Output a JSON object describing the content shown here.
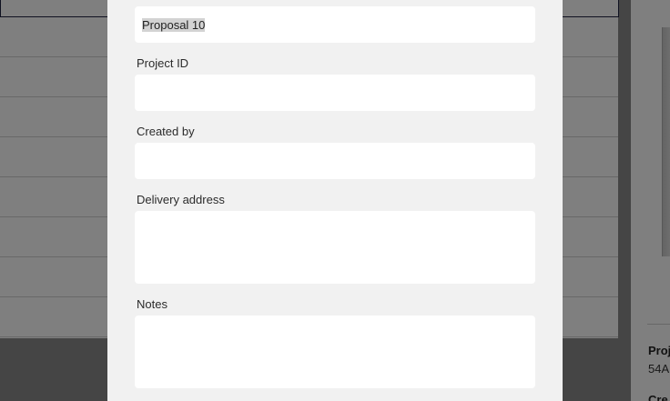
{
  "background": {
    "meta": {
      "project_label": "Proj",
      "project_value": "54A",
      "created_label": "Cre"
    }
  },
  "modal": {
    "fields": {
      "name": {
        "value": "Proposal 10"
      },
      "project_id": {
        "label": "Project ID",
        "value": ""
      },
      "created_by": {
        "label": "Created by",
        "value": ""
      },
      "delivery_address": {
        "label": "Delivery address",
        "value": ""
      },
      "notes": {
        "label": "Notes",
        "value": ""
      }
    }
  }
}
